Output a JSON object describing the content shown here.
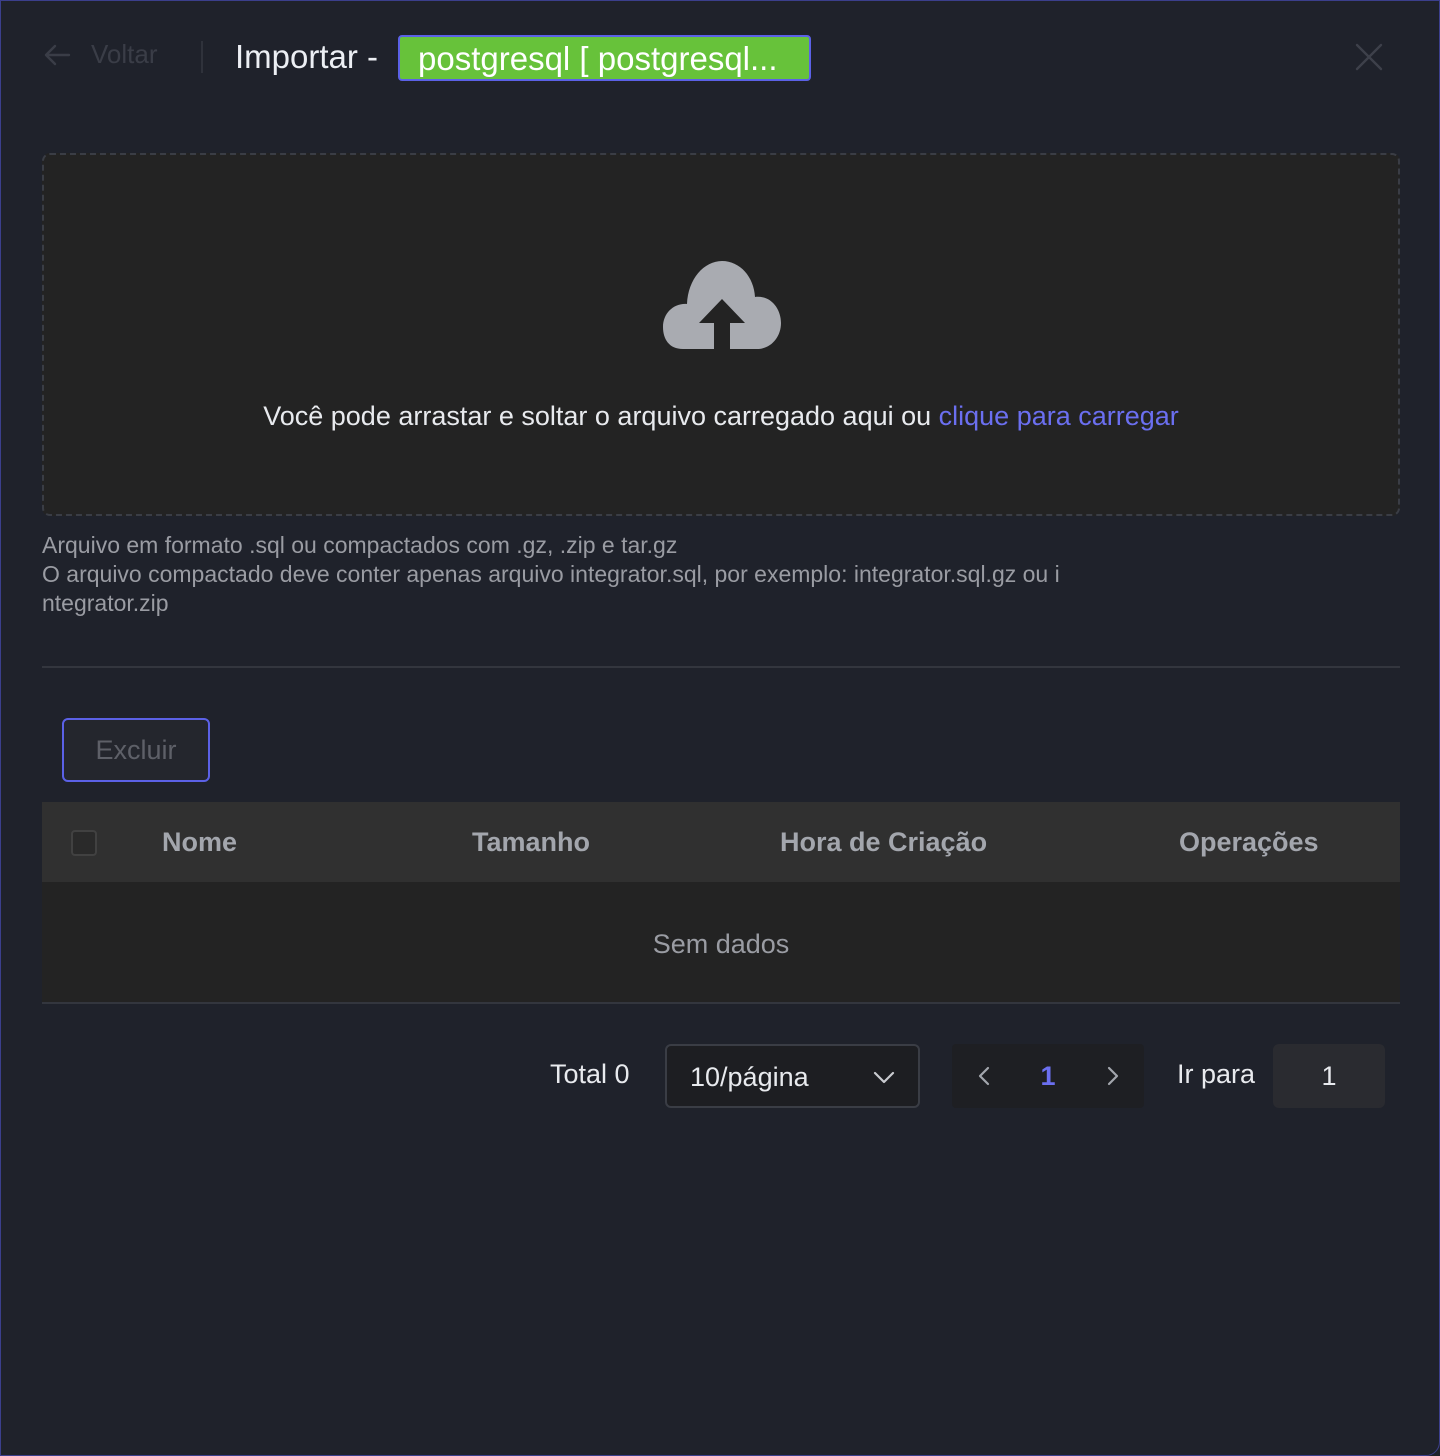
{
  "header": {
    "back_label": "Voltar",
    "title": "Importar -",
    "database_tag": "postgresql [ postgresql..."
  },
  "upload": {
    "prompt_text": "Você pode arrastar e soltar o arquivo carregado aqui ou ",
    "link_text": "clique para carregar",
    "tip_line_1": "Arquivo em formato .sql ou compactados com .gz, .zip e tar.gz",
    "tip_line_2": "O arquivo compactado deve conter apenas arquivo integrator.sql, por exemplo: integrator.sql.gz ou i",
    "tip_line_3": "ntegrator.zip"
  },
  "toolbar": {
    "delete_label": "Excluir"
  },
  "table": {
    "columns": [
      "Nome",
      "Tamanho",
      "Hora de Criação",
      "Operações"
    ],
    "empty_text": "Sem dados"
  },
  "pagination": {
    "total_label": "Total 0",
    "page_size": "10/página",
    "current_page": "1",
    "goto_label": "Ir para",
    "goto_value": "1"
  },
  "colors": {
    "accent": "#5b61e6",
    "link": "#6b6ff0",
    "tag_green": "#67c23a",
    "background": "#1f222b"
  }
}
